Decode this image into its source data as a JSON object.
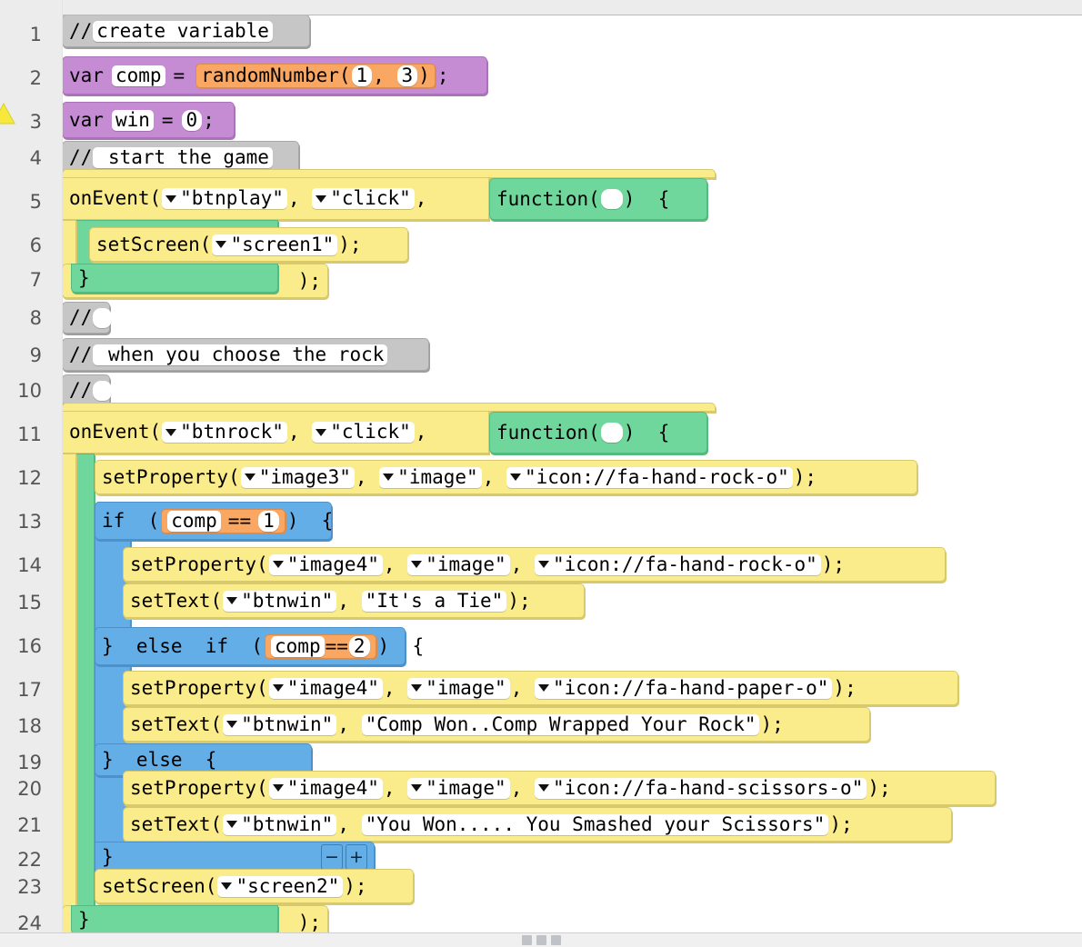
{
  "editor": {
    "title": "Code.org App Lab block code editor",
    "language": "javascript-blocks",
    "gutter_line_start": 1,
    "gutter_line_end": 24,
    "warning_line": 3,
    "warning_icon": "warning-triangle-icon"
  },
  "colors": {
    "comment_gray": "#c6c6c6",
    "variable_purple": "#c58bd3",
    "function_yellow": "#fbec8b",
    "callback_green": "#6fd79b",
    "control_blue": "#64aee8",
    "expression_orange": "#f9a763",
    "gutter_bg": "#ececec",
    "canvas_bg": "#ffffff"
  },
  "line_numbers": [
    "1",
    "2",
    "3",
    "4",
    "5",
    "6",
    "7",
    "8",
    "9",
    "10",
    "11",
    "12",
    "13",
    "14",
    "15",
    "16",
    "17",
    "18",
    "19",
    "20",
    "21",
    "22",
    "23",
    "24"
  ],
  "lines": {
    "l1": {
      "kw": "//",
      "text": "create variable"
    },
    "l2": {
      "kw": "var",
      "name": "comp",
      "eq": "=",
      "call": "randomNumber(",
      "a": "1",
      "comma": ", ",
      "b": "3",
      "close": ")",
      "semi": ";"
    },
    "l3": {
      "kw": "var",
      "name": "win",
      "eq": "=",
      "value": "0",
      "semi": ";"
    },
    "l4": {
      "kw": "//",
      "text": " start the game"
    },
    "l5": {
      "fn": "onEvent(",
      "arg1": "\"btnplay\"",
      "sep1": ", ",
      "arg2": "\"click\"",
      "sep2": ", ",
      "cb": "function(",
      "cbparam": "",
      "cbclose": ")  {"
    },
    "l6": {
      "fn": "setScreen(",
      "arg1": "\"screen1\"",
      "close": ");"
    },
    "l7": {
      "brace": "}",
      "close": ");"
    },
    "l8": {
      "kw": "//",
      "text": ""
    },
    "l9": {
      "kw": "//",
      "text": " when you choose the rock"
    },
    "l10": {
      "kw": "//",
      "text": ""
    },
    "l11": {
      "fn": "onEvent(",
      "arg1": "\"btnrock\"",
      "sep1": ", ",
      "arg2": "\"click\"",
      "sep2": ", ",
      "cb": "function(",
      "cbparam": "",
      "cbclose": ")  {"
    },
    "l12": {
      "fn": "setProperty(",
      "arg1": "\"image3\"",
      "sep1": ", ",
      "arg2": "\"image\"",
      "sep2": ", ",
      "arg3": "\"icon://fa-hand-rock-o\"",
      "close": ");"
    },
    "l13": {
      "kw": "if  (",
      "var": "comp",
      "op": "==",
      "val": "1",
      "close": ")  {"
    },
    "l14": {
      "fn": "setProperty(",
      "arg1": "\"image4\"",
      "sep1": ", ",
      "arg2": "\"image\"",
      "sep2": ", ",
      "arg3": "\"icon://fa-hand-rock-o\"",
      "close": ");"
    },
    "l15": {
      "fn": "setText(",
      "arg1": "\"btnwin\"",
      "sep1": ", ",
      "arg2": "\"It's a Tie\"",
      "close": ");"
    },
    "l16": {
      "kw": "}  else  if  (",
      "var": "comp",
      "op": "==",
      "val": "2",
      "close": ")  {"
    },
    "l17": {
      "fn": "setProperty(",
      "arg1": "\"image4\"",
      "sep1": ", ",
      "arg2": "\"image\"",
      "sep2": ", ",
      "arg3": "\"icon://fa-hand-paper-o\"",
      "close": ");"
    },
    "l18": {
      "fn": "setText(",
      "arg1": "\"btnwin\"",
      "sep1": ", ",
      "arg2": "\"Comp Won..Comp Wrapped Your Rock\"",
      "close": ");"
    },
    "l19": {
      "kw": "}  else  {"
    },
    "l20": {
      "fn": "setProperty(",
      "arg1": "\"image4\"",
      "sep1": ", ",
      "arg2": "\"image\"",
      "sep2": ", ",
      "arg3": "\"icon://fa-hand-scissors-o\"",
      "close": ");"
    },
    "l21": {
      "fn": "setText(",
      "arg1": "\"btnwin\"",
      "sep1": ", ",
      "arg2": "\"You Won..... You Smashed your Scissors\"",
      "close": ");"
    },
    "l22": {
      "brace": "}",
      "minus": "−",
      "plus": "+"
    },
    "l23": {
      "fn": "setScreen(",
      "arg1": "\"screen2\"",
      "close": ");"
    },
    "l24": {
      "brace": "}",
      "close": ");"
    }
  },
  "footer": {
    "handle": "resize-drag-handle"
  }
}
